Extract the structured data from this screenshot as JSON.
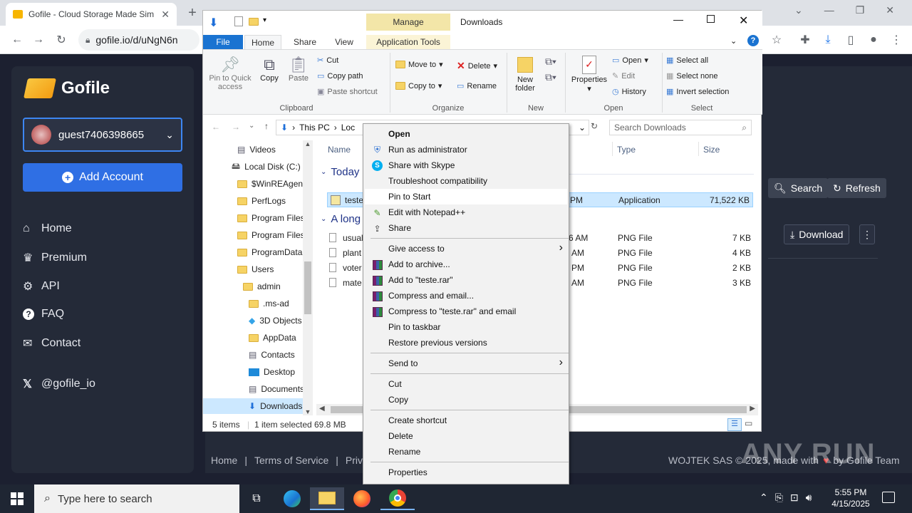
{
  "chrome": {
    "tab_title": "Gofile - Cloud Storage Made Sim",
    "url": "gofile.io/d/uNgN6n"
  },
  "gofile": {
    "logo_text": "Gofile",
    "account_name": "guest7406398665",
    "add_account_label": "Add Account",
    "nav": [
      {
        "label": "Home",
        "icon": "home-icon"
      },
      {
        "label": "Premium",
        "icon": "crown-icon"
      },
      {
        "label": "API",
        "icon": "gears-icon"
      },
      {
        "label": "FAQ",
        "icon": "question-icon"
      },
      {
        "label": "Contact",
        "icon": "envelope-icon"
      }
    ],
    "social": "@gofile_io",
    "search_label": "Search",
    "refresh_label": "Refresh",
    "download_label": "Download",
    "footer_links": [
      "Home",
      "Terms of Service",
      "Privacy"
    ],
    "footer_right": "WOJTEK SAS © 2025, made with",
    "footer_right_tail": "by Gofile Team"
  },
  "explorer": {
    "title": "Downloads",
    "manage_label": "Manage",
    "tabs": [
      "File",
      "Home",
      "Share",
      "View",
      "Application Tools"
    ],
    "clipboard": {
      "pin_label": "Pin to Quick access",
      "copy_label": "Copy",
      "paste_label": "Paste",
      "cut_label": "Cut",
      "copy_path_label": "Copy path",
      "paste_shortcut_label": "Paste shortcut",
      "group_label": "Clipboard"
    },
    "organize": {
      "move_to": "Move to",
      "copy_to": "Copy to",
      "delete": "Delete",
      "rename": "Rename",
      "group_label": "Organize"
    },
    "new_group": {
      "new_folder": "New folder",
      "group_label": "New"
    },
    "open_group": {
      "properties": "Properties",
      "open": "Open",
      "edit": "Edit",
      "history": "History",
      "group_label": "Open"
    },
    "select_group": {
      "select_all": "Select all",
      "select_none": "Select none",
      "invert": "Invert selection",
      "group_label": "Select"
    },
    "breadcrumb": [
      "This PC",
      "Loc"
    ],
    "search_placeholder": "Search Downloads",
    "nav_items": [
      {
        "label": "Videos",
        "indent": 1
      },
      {
        "label": "Local Disk (C:)",
        "indent": 0
      },
      {
        "label": "$WinREAgent",
        "indent": 1
      },
      {
        "label": "PerfLogs",
        "indent": 1
      },
      {
        "label": "Program Files",
        "indent": 1
      },
      {
        "label": "Program Files",
        "indent": 1
      },
      {
        "label": "ProgramData",
        "indent": 1
      },
      {
        "label": "Users",
        "indent": 1
      },
      {
        "label": "admin",
        "indent": 2
      },
      {
        "label": ".ms-ad",
        "indent": 3
      },
      {
        "label": "3D Objects",
        "indent": 3
      },
      {
        "label": "AppData",
        "indent": 3
      },
      {
        "label": "Contacts",
        "indent": 3
      },
      {
        "label": "Desktop",
        "indent": 3
      },
      {
        "label": "Documents",
        "indent": 3
      },
      {
        "label": "Downloads",
        "indent": 3
      }
    ],
    "columns": {
      "name": "Name",
      "type": "Type",
      "size": "Size"
    },
    "groups": {
      "today": "Today",
      "long_ago": "A long"
    },
    "files_today": [
      {
        "name": "teste.",
        "time": "PM",
        "type": "Application",
        "size": "71,522 KB"
      }
    ],
    "files_old": [
      {
        "name": "usual",
        "time": "6 AM",
        "type": "PNG File",
        "size": "7 KB"
      },
      {
        "name": "plant",
        "time": "AM",
        "type": "PNG File",
        "size": "4 KB"
      },
      {
        "name": "voter",
        "time": "PM",
        "type": "PNG File",
        "size": "2 KB"
      },
      {
        "name": "mate",
        "time": "AM",
        "type": "PNG File",
        "size": "3 KB"
      }
    ],
    "status": {
      "count": "5 items",
      "selected": "1 item selected",
      "size": "69.8 MB"
    }
  },
  "context_menu": {
    "items": [
      {
        "label": "Open",
        "bold": true,
        "icon": ""
      },
      {
        "label": "Run as administrator",
        "icon": "shield-icon"
      },
      {
        "label": "Share with Skype",
        "icon": "skype-icon"
      },
      {
        "label": "Troubleshoot compatibility",
        "icon": ""
      },
      {
        "label": "Pin to Start",
        "icon": "",
        "highlighted": true
      },
      {
        "label": "Edit with Notepad++",
        "icon": "notepad-icon"
      },
      {
        "label": "Share",
        "icon": "share-icon"
      },
      {
        "sep": true
      },
      {
        "label": "Give access to",
        "submenu": true,
        "icon": ""
      },
      {
        "label": "Add to archive...",
        "icon": "rar-icon"
      },
      {
        "label": "Add to \"teste.rar\"",
        "icon": "rar-icon"
      },
      {
        "label": "Compress and email...",
        "icon": "rar-icon"
      },
      {
        "label": "Compress to \"teste.rar\" and email",
        "icon": "rar-icon"
      },
      {
        "label": "Pin to taskbar",
        "icon": ""
      },
      {
        "label": "Restore previous versions",
        "icon": ""
      },
      {
        "sep": true
      },
      {
        "label": "Send to",
        "submenu": true,
        "icon": ""
      },
      {
        "sep": true
      },
      {
        "label": "Cut",
        "icon": ""
      },
      {
        "label": "Copy",
        "icon": ""
      },
      {
        "sep": true
      },
      {
        "label": "Create shortcut",
        "icon": ""
      },
      {
        "label": "Delete",
        "icon": ""
      },
      {
        "label": "Rename",
        "icon": ""
      },
      {
        "sep": true
      },
      {
        "label": "Properties",
        "icon": ""
      }
    ]
  },
  "taskbar": {
    "search_placeholder": "Type here to search",
    "time": "5:55 PM",
    "date": "4/15/2025"
  },
  "watermark": "ANY RUN"
}
